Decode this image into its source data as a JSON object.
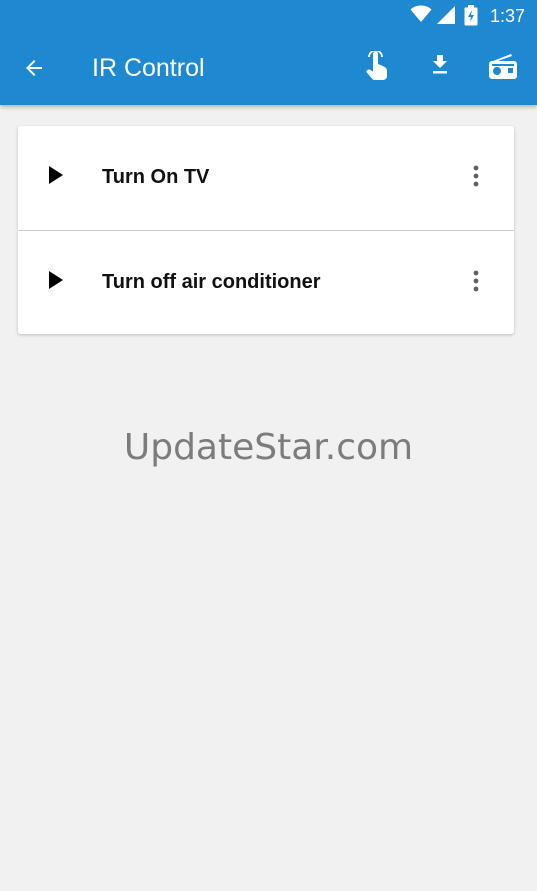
{
  "status_bar": {
    "time": "1:37",
    "icons": [
      "wifi-icon",
      "cell-signal-icon",
      "battery-charging-icon"
    ]
  },
  "app_bar": {
    "title": "IR Control",
    "color": "#1e88d0",
    "actions": [
      "back-arrow-icon",
      "touch-icon",
      "download-icon",
      "radio-icon"
    ]
  },
  "commands": [
    {
      "label": "Turn On TV",
      "icon": "play-icon",
      "menu_icon": "more-vert-icon"
    },
    {
      "label": "Turn off air conditioner",
      "icon": "play-icon",
      "menu_icon": "more-vert-icon"
    }
  ],
  "watermark": "UpdateStar.com"
}
